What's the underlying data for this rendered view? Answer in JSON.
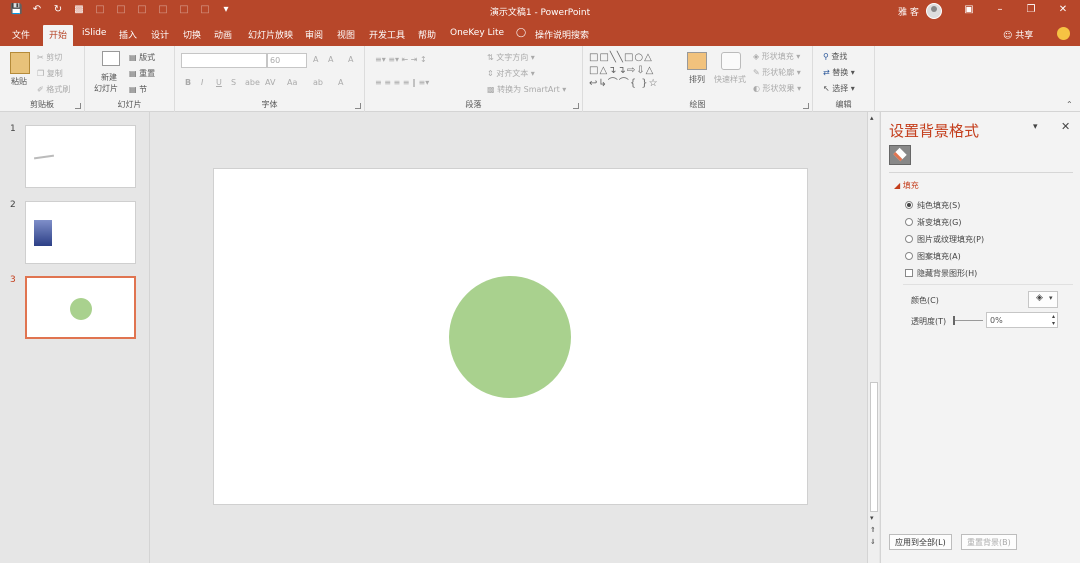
{
  "window": {
    "title": "演示文稿1  -  PowerPoint",
    "user": "雅 客",
    "colors": {
      "accent": "#b7472a",
      "circle_fill": "#a9d18e",
      "selected_border": "#e07450"
    }
  },
  "tabs": [
    {
      "label": "文件"
    },
    {
      "label": "开始"
    },
    {
      "label": "iSlide"
    },
    {
      "label": "插入"
    },
    {
      "label": "设计"
    },
    {
      "label": "切换"
    },
    {
      "label": "动画"
    },
    {
      "label": "幻灯片放映"
    },
    {
      "label": "审阅"
    },
    {
      "label": "视图"
    },
    {
      "label": "开发工具"
    },
    {
      "label": "帮助"
    },
    {
      "label": "OneKey Lite"
    },
    {
      "label": "操作说明搜索"
    }
  ],
  "share_label": "共享",
  "ribbon": {
    "clipboard": {
      "label": "剪贴板",
      "paste": "粘贴",
      "cut": "剪切",
      "copy": "复制",
      "format_painter": "格式刷"
    },
    "slides": {
      "label": "幻灯片",
      "new_slide_1": "新建",
      "new_slide_2": "幻灯片",
      "layout": "版式",
      "reset": "重置",
      "section": "节"
    },
    "font": {
      "label": "字体",
      "font_name": "",
      "font_size": "60",
      "bold": "B",
      "italic": "I",
      "underline": "U",
      "strike": "S",
      "shadow": "abe",
      "spacing": "AV",
      "case": "Aa",
      "grow": "A",
      "shrink": "A",
      "clear": "A",
      "highlight": "ab",
      "color": "A"
    },
    "paragraph": {
      "label": "段落",
      "text_direction": "文字方向",
      "align_text": "对齐文本",
      "smartart": "转换为 SmartArt"
    },
    "drawing": {
      "label": "绘图",
      "arrange": "排列",
      "quick_styles": "快速样式",
      "shape_fill": "形状填充",
      "shape_outline": "形状轮廓",
      "shape_effects": "形状效果"
    },
    "editing": {
      "label": "编辑",
      "find": "查找",
      "replace": "替换",
      "select": "选择"
    }
  },
  "thumbnails": [
    {
      "number": "1"
    },
    {
      "number": "2"
    },
    {
      "number": "3"
    }
  ],
  "format_pane": {
    "title": "设置背景格式",
    "section": "填充",
    "options": [
      {
        "label": "纯色填充(S)",
        "checked": true
      },
      {
        "label": "渐变填充(G)",
        "checked": false
      },
      {
        "label": "图片或纹理填充(P)",
        "checked": false
      },
      {
        "label": "图案填充(A)",
        "checked": false
      }
    ],
    "hide_background": "隐藏背景图形(H)",
    "color_label": "颜色(C)",
    "transparency_label": "透明度(T)",
    "transparency_value": "0%",
    "apply_all": "应用到全部(L)",
    "reset_background": "重置背景(B)"
  }
}
